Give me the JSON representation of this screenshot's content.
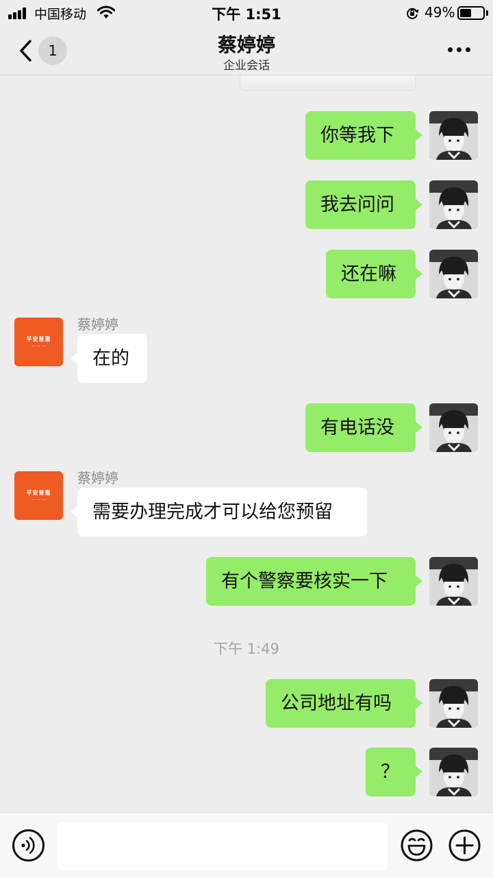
{
  "status_bar": {
    "carrier": "中国移动",
    "time": "下午 1:51",
    "battery_percent": "49%",
    "battery_level": 0.49,
    "icons": [
      "signal-icon",
      "wifi-icon",
      "orientation-lock-icon",
      "battery-icon"
    ]
  },
  "nav": {
    "back_icon": "chevron-left-icon",
    "unread_badge": "1",
    "title": "蔡婷婷",
    "subtitle": "企业会话",
    "more_icon": "more-dots-icon"
  },
  "messages": [
    {
      "from": "me",
      "text": "你等我下"
    },
    {
      "from": "me",
      "text": "我去问问"
    },
    {
      "from": "me",
      "text": "还在嘛"
    },
    {
      "from": "them",
      "sender": "蔡婷婷",
      "text": "在的"
    },
    {
      "from": "me",
      "text": "有电话没"
    },
    {
      "from": "them",
      "sender": "蔡婷婷",
      "text": "需要办理完成才可以给您预留"
    },
    {
      "from": "me",
      "text": "有个警察要核实一下"
    },
    {
      "timestamp": "下午 1:49"
    },
    {
      "from": "me",
      "text": "公司地址有吗"
    },
    {
      "from": "me",
      "text": "？"
    }
  ],
  "input_bar": {
    "voice_icon": "voice-icon",
    "input_value": "",
    "emoji_icon": "emoji-icon",
    "plus_icon": "plus-icon"
  },
  "colors": {
    "background": "#ededed",
    "my_bubble": "#95ec69",
    "their_bubble": "#ffffff",
    "their_avatar": "#f05a23"
  }
}
